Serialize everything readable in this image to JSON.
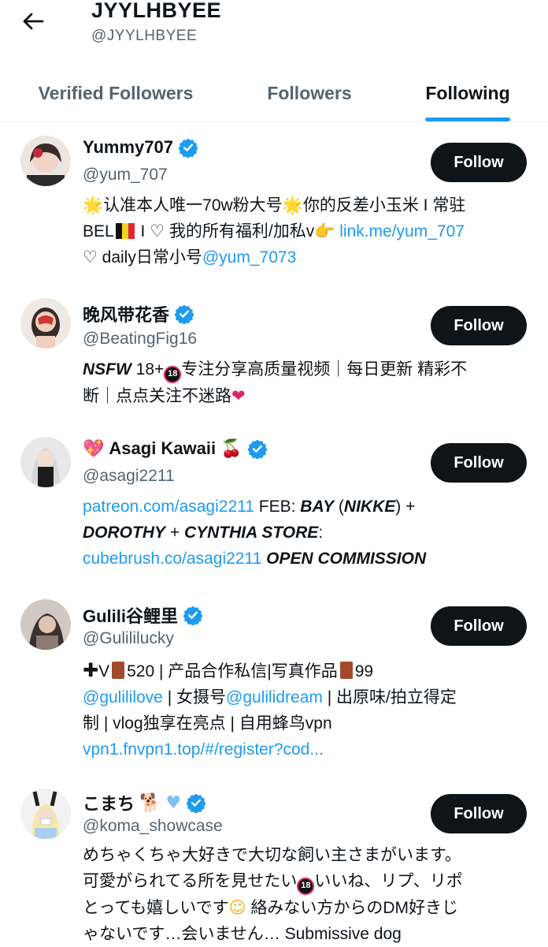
{
  "header": {
    "title": "JYYLHBYEE",
    "handle": "@JYYLHBYEE"
  },
  "tabs": [
    {
      "label": "Verified Followers",
      "active": false
    },
    {
      "label": "Followers",
      "active": false
    },
    {
      "label": "Following",
      "active": true
    }
  ],
  "colors": {
    "accent": "#1d9bf0",
    "button_bg": "#0f1419",
    "secondary_text": "#536471"
  },
  "follow_label": "Follow",
  "users": [
    {
      "name": "Yummy707",
      "handle": "@yum_707",
      "verified": true,
      "bio_line1_a": "认准本人唯一70w粉大号",
      "bio_line1_b": "你的反差小玉米 I 常驻",
      "bio_line2_a": "BEL",
      "bio_line2_b": " I ♡ 我的所有福利/加私v",
      "bio_line2_link": "link.me/yum_707",
      "bio_line3_a": "♡ daily日常小号",
      "bio_line3_link": "@yum_7073"
    },
    {
      "name": "晚风带花香",
      "handle": "@BeatingFig16",
      "verified": true,
      "bio_nsfw": "NSFW",
      "bio_line1": " 18+",
      "bio_line1_b": "专注分享高质量视频｜每日更新 精彩不",
      "bio_line2": "断｜点点关注不迷路"
    },
    {
      "name": "Asagi Kawaii",
      "handle": "@asagi2211",
      "verified": true,
      "bio_link1": "patreon.com/asagi2211",
      "bio_t1": " FEB: ",
      "bio_b1": "BAY",
      "bio_t2": " (",
      "bio_b2": "NIKKE",
      "bio_t3": ") +",
      "bio_b3": "DOROTHY",
      "bio_t4": " + ",
      "bio_b4": "CYNTHIA STORE",
      "bio_t5": ":",
      "bio_link2": "cubebrush.co/asagi2211",
      "bio_b5": "OPEN COMMISSION"
    },
    {
      "name": "Gulili谷鲤里",
      "handle": "@Gulililucky",
      "verified": true,
      "bio_line1_a": "V",
      "bio_line1_b": "520 | 产品合作私信|写真作品",
      "bio_line1_c": "99",
      "bio_link1": "@gulililove",
      "bio_line2_a": " | 女摄号",
      "bio_link2": "@gulilidream",
      "bio_line2_b": " | 出原味/拍立得定",
      "bio_line3": "制 | vlog独享在亮点 | 自用蜂鸟vpn",
      "bio_link3": "vpn1.fnvpn1.top/#/register?cod..."
    },
    {
      "name": "こまち",
      "handle": "@koma_showcase",
      "verified": true,
      "bio_line1": "めちゃくちゃ大好きで大切な飼い主さまがいます。",
      "bio_line2_a": "可愛がられてる所を見せたい",
      "bio_line2_b": "いいね、リプ、リポ",
      "bio_line3_a": "とっても嬉しいです",
      "bio_line3_b": " 絡みない方からのDM好きじ",
      "bio_line4": "ゃないです…会いません… Submissive dog"
    }
  ]
}
